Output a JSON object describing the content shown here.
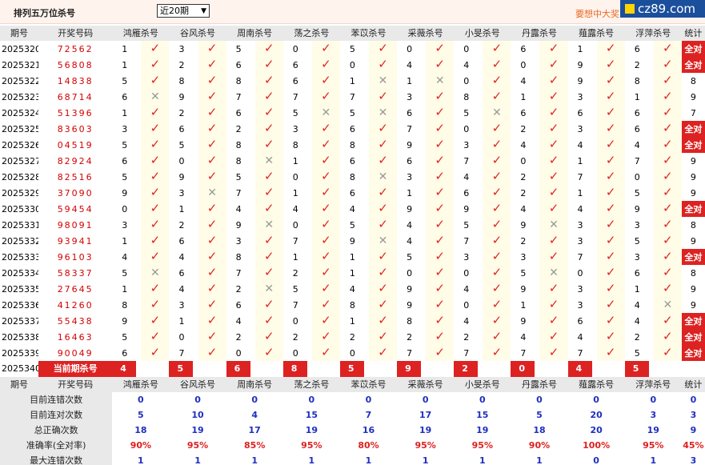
{
  "header": {
    "title": "排列五万位杀号",
    "period_select": "近20期",
    "marquee": "要想中大奖",
    "logo": "cz89.com"
  },
  "columns": {
    "period": "期号",
    "number": "开奖号码",
    "kills": [
      "鸿雁杀号",
      "谷风杀号",
      "周南杀号",
      "荡之杀号",
      "苯苡杀号",
      "采薇杀号",
      "小旻杀号",
      "丹露杀号",
      "薤露杀号",
      "浮萍杀号"
    ],
    "stat": "统计"
  },
  "rows": [
    {
      "period": "2025320",
      "number": "72562",
      "kills": [
        [
          1,
          1
        ],
        [
          3,
          1
        ],
        [
          5,
          1
        ],
        [
          0,
          1
        ],
        [
          5,
          1
        ],
        [
          0,
          1
        ],
        [
          0,
          1
        ],
        [
          6,
          1
        ],
        [
          1,
          1
        ],
        [
          6,
          1
        ]
      ],
      "stat": "全对"
    },
    {
      "period": "2025321",
      "number": "56808",
      "kills": [
        [
          1,
          1
        ],
        [
          2,
          1
        ],
        [
          6,
          1
        ],
        [
          6,
          1
        ],
        [
          0,
          1
        ],
        [
          4,
          1
        ],
        [
          4,
          1
        ],
        [
          0,
          1
        ],
        [
          9,
          1
        ],
        [
          2,
          1
        ]
      ],
      "stat": "全对"
    },
    {
      "period": "2025322",
      "number": "14838",
      "kills": [
        [
          5,
          1
        ],
        [
          8,
          1
        ],
        [
          8,
          1
        ],
        [
          6,
          1
        ],
        [
          1,
          0
        ],
        [
          1,
          0
        ],
        [
          0,
          1
        ],
        [
          4,
          1
        ],
        [
          9,
          1
        ],
        [
          8,
          1
        ]
      ],
      "stat": "8"
    },
    {
      "period": "2025323",
      "number": "68714",
      "kills": [
        [
          6,
          0
        ],
        [
          9,
          1
        ],
        [
          7,
          1
        ],
        [
          7,
          1
        ],
        [
          7,
          1
        ],
        [
          3,
          1
        ],
        [
          8,
          1
        ],
        [
          1,
          1
        ],
        [
          3,
          1
        ],
        [
          1,
          1
        ]
      ],
      "stat": "9"
    },
    {
      "period": "2025324",
      "number": "51396",
      "kills": [
        [
          1,
          1
        ],
        [
          2,
          1
        ],
        [
          6,
          1
        ],
        [
          5,
          0
        ],
        [
          5,
          0
        ],
        [
          6,
          1
        ],
        [
          5,
          0
        ],
        [
          6,
          1
        ],
        [
          6,
          1
        ],
        [
          6,
          1
        ]
      ],
      "stat": "7"
    },
    {
      "period": "2025325",
      "number": "83603",
      "kills": [
        [
          3,
          1
        ],
        [
          6,
          1
        ],
        [
          2,
          1
        ],
        [
          3,
          1
        ],
        [
          6,
          1
        ],
        [
          7,
          1
        ],
        [
          0,
          1
        ],
        [
          2,
          1
        ],
        [
          3,
          1
        ],
        [
          6,
          1
        ]
      ],
      "stat": "全对"
    },
    {
      "period": "2025326",
      "number": "04519",
      "kills": [
        [
          5,
          1
        ],
        [
          5,
          1
        ],
        [
          8,
          1
        ],
        [
          8,
          1
        ],
        [
          8,
          1
        ],
        [
          9,
          1
        ],
        [
          3,
          1
        ],
        [
          4,
          1
        ],
        [
          4,
          1
        ],
        [
          4,
          1
        ]
      ],
      "stat": "全对"
    },
    {
      "period": "2025327",
      "number": "82924",
      "kills": [
        [
          6,
          1
        ],
        [
          0,
          1
        ],
        [
          8,
          0
        ],
        [
          1,
          1
        ],
        [
          6,
          1
        ],
        [
          6,
          1
        ],
        [
          7,
          1
        ],
        [
          0,
          1
        ],
        [
          1,
          1
        ],
        [
          7,
          1
        ]
      ],
      "stat": "9"
    },
    {
      "period": "2025328",
      "number": "82516",
      "kills": [
        [
          5,
          1
        ],
        [
          9,
          1
        ],
        [
          5,
          1
        ],
        [
          0,
          1
        ],
        [
          8,
          0
        ],
        [
          3,
          1
        ],
        [
          4,
          1
        ],
        [
          2,
          1
        ],
        [
          7,
          1
        ],
        [
          0,
          1
        ]
      ],
      "stat": "9"
    },
    {
      "period": "2025329",
      "number": "37090",
      "kills": [
        [
          9,
          1
        ],
        [
          3,
          0
        ],
        [
          7,
          1
        ],
        [
          1,
          1
        ],
        [
          6,
          1
        ],
        [
          1,
          1
        ],
        [
          6,
          1
        ],
        [
          2,
          1
        ],
        [
          1,
          1
        ],
        [
          5,
          1
        ]
      ],
      "stat": "9"
    },
    {
      "period": "2025330",
      "number": "59454",
      "kills": [
        [
          0,
          1
        ],
        [
          1,
          1
        ],
        [
          4,
          1
        ],
        [
          4,
          1
        ],
        [
          4,
          1
        ],
        [
          9,
          1
        ],
        [
          9,
          1
        ],
        [
          4,
          1
        ],
        [
          4,
          1
        ],
        [
          9,
          1
        ]
      ],
      "stat": "全对"
    },
    {
      "period": "2025331",
      "number": "98091",
      "kills": [
        [
          3,
          1
        ],
        [
          2,
          1
        ],
        [
          9,
          0
        ],
        [
          0,
          1
        ],
        [
          5,
          1
        ],
        [
          4,
          1
        ],
        [
          5,
          1
        ],
        [
          9,
          0
        ],
        [
          3,
          1
        ],
        [
          3,
          1
        ]
      ],
      "stat": "8"
    },
    {
      "period": "2025332",
      "number": "93941",
      "kills": [
        [
          1,
          1
        ],
        [
          6,
          1
        ],
        [
          3,
          1
        ],
        [
          7,
          1
        ],
        [
          9,
          0
        ],
        [
          4,
          1
        ],
        [
          7,
          1
        ],
        [
          2,
          1
        ],
        [
          3,
          1
        ],
        [
          5,
          1
        ]
      ],
      "stat": "9"
    },
    {
      "period": "2025333",
      "number": "96103",
      "kills": [
        [
          4,
          1
        ],
        [
          4,
          1
        ],
        [
          8,
          1
        ],
        [
          1,
          1
        ],
        [
          1,
          1
        ],
        [
          5,
          1
        ],
        [
          3,
          1
        ],
        [
          3,
          1
        ],
        [
          7,
          1
        ],
        [
          3,
          1
        ]
      ],
      "stat": "全对"
    },
    {
      "period": "2025334",
      "number": "58337",
      "kills": [
        [
          5,
          0
        ],
        [
          6,
          1
        ],
        [
          7,
          1
        ],
        [
          2,
          1
        ],
        [
          1,
          1
        ],
        [
          0,
          1
        ],
        [
          0,
          1
        ],
        [
          5,
          0
        ],
        [
          0,
          1
        ],
        [
          6,
          1
        ]
      ],
      "stat": "8"
    },
    {
      "period": "2025335",
      "number": "27645",
      "kills": [
        [
          1,
          1
        ],
        [
          4,
          1
        ],
        [
          2,
          0
        ],
        [
          5,
          1
        ],
        [
          4,
          1
        ],
        [
          9,
          1
        ],
        [
          4,
          1
        ],
        [
          9,
          1
        ],
        [
          3,
          1
        ],
        [
          1,
          1
        ]
      ],
      "stat": "9"
    },
    {
      "period": "2025336",
      "number": "41260",
      "kills": [
        [
          8,
          1
        ],
        [
          3,
          1
        ],
        [
          6,
          1
        ],
        [
          7,
          1
        ],
        [
          8,
          1
        ],
        [
          9,
          1
        ],
        [
          0,
          1
        ],
        [
          1,
          1
        ],
        [
          3,
          1
        ],
        [
          4,
          0
        ]
      ],
      "stat": "9"
    },
    {
      "period": "2025337",
      "number": "55438",
      "kills": [
        [
          9,
          1
        ],
        [
          1,
          1
        ],
        [
          4,
          1
        ],
        [
          0,
          1
        ],
        [
          1,
          1
        ],
        [
          8,
          1
        ],
        [
          4,
          1
        ],
        [
          9,
          1
        ],
        [
          6,
          1
        ],
        [
          4,
          1
        ]
      ],
      "stat": "全对"
    },
    {
      "period": "2025338",
      "number": "16463",
      "kills": [
        [
          5,
          1
        ],
        [
          0,
          1
        ],
        [
          2,
          1
        ],
        [
          2,
          1
        ],
        [
          2,
          1
        ],
        [
          2,
          1
        ],
        [
          2,
          1
        ],
        [
          4,
          1
        ],
        [
          4,
          1
        ],
        [
          2,
          1
        ]
      ],
      "stat": "全对"
    },
    {
      "period": "2025339",
      "number": "90049",
      "kills": [
        [
          6,
          1
        ],
        [
          7,
          1
        ],
        [
          0,
          1
        ],
        [
          0,
          1
        ],
        [
          0,
          1
        ],
        [
          7,
          1
        ],
        [
          7,
          1
        ],
        [
          7,
          1
        ],
        [
          7,
          1
        ],
        [
          5,
          1
        ]
      ],
      "stat": "全对"
    }
  ],
  "current": {
    "period": "2025340",
    "label": "当前期杀号",
    "picks": [
      "4",
      "5",
      "6",
      "8",
      "5",
      "9",
      "2",
      "0",
      "4",
      "5"
    ]
  },
  "stats": [
    {
      "label": "目前连错次数",
      "values": [
        "0",
        "0",
        "0",
        "0",
        "0",
        "0",
        "0",
        "0",
        "0",
        "0"
      ],
      "total": "0",
      "pct": false
    },
    {
      "label": "目前连对次数",
      "values": [
        "5",
        "10",
        "4",
        "15",
        "7",
        "17",
        "15",
        "5",
        "20",
        "3"
      ],
      "total": "3",
      "pct": false
    },
    {
      "label": "总正确次数",
      "values": [
        "18",
        "19",
        "17",
        "19",
        "16",
        "19",
        "19",
        "18",
        "20",
        "19"
      ],
      "total": "9",
      "pct": false
    },
    {
      "label": "准确率(全对率)",
      "values": [
        "90%",
        "95%",
        "85%",
        "95%",
        "80%",
        "95%",
        "95%",
        "90%",
        "100%",
        "95%"
      ],
      "total": "45%",
      "pct": true
    },
    {
      "label": "最大连错次数",
      "values": [
        "1",
        "1",
        "1",
        "1",
        "1",
        "1",
        "1",
        "1",
        "0",
        "1"
      ],
      "total": "3",
      "pct": false
    },
    {
      "label": "最大连对次数",
      "values": [
        "10",
        "10",
        "7",
        "15",
        "7",
        "17",
        "15",
        "11",
        "20",
        "16"
      ],
      "total": "3",
      "pct": false
    }
  ],
  "colors": {
    "accent_red": "#dd2222",
    "stat_blue": "#1f2fbf",
    "header_bg": "#e9e9e9",
    "check": "#e02424",
    "cross": "#9a9a9a"
  },
  "icons": {
    "correct": "check-icon",
    "wrong": "cross-icon"
  }
}
